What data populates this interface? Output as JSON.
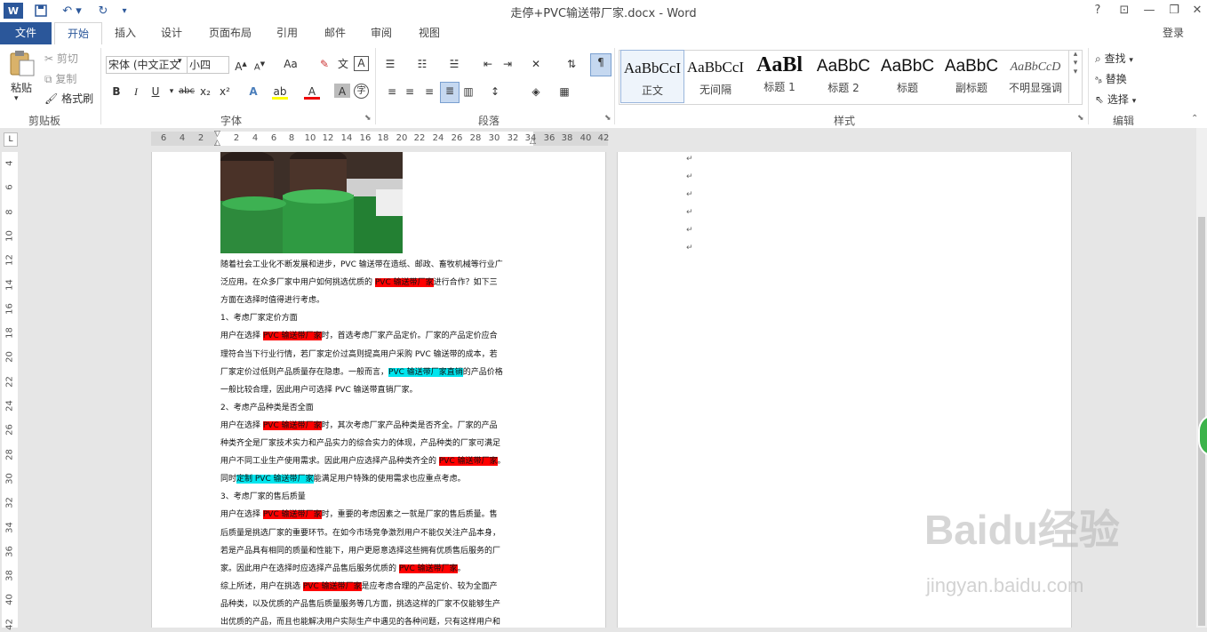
{
  "window": {
    "title": "走停+PVC输送带厂家.docx - Word",
    "controls": {
      "help": "?",
      "restore_ribbon": "⊡",
      "minimize": "—",
      "maximize": "❐",
      "close": "✕"
    },
    "signin": "登录"
  },
  "tabs": [
    "文件",
    "开始",
    "插入",
    "设计",
    "页面布局",
    "引用",
    "邮件",
    "审阅",
    "视图"
  ],
  "clipboard": {
    "paste": "粘贴",
    "cut": "剪切",
    "copy": "复制",
    "format_painter": "格式刷",
    "group": "剪贴板"
  },
  "font": {
    "family": "宋体 (中文正文",
    "size": "小四",
    "group": "字体",
    "change_case": "Aa",
    "bold": "B",
    "italic": "I",
    "underline": "U",
    "strike": "abc",
    "subscript": "x₂",
    "superscript": "x²"
  },
  "paragraph": {
    "group": "段落"
  },
  "styles": {
    "group": "样式",
    "items": [
      {
        "sample": "AaBbCcI",
        "name": "正文"
      },
      {
        "sample": "AaBbCcI",
        "name": "无间隔"
      },
      {
        "sample": "AaBl",
        "name": "标题 1"
      },
      {
        "sample": "AaBbC",
        "name": "标题 2"
      },
      {
        "sample": "AaBbC",
        "name": "标题"
      },
      {
        "sample": "AaBbC",
        "name": "副标题"
      },
      {
        "sample": "AaBbCcD",
        "name": "不明显强调"
      }
    ]
  },
  "editing": {
    "find": "查找",
    "replace": "替换",
    "select": "选择",
    "group": "编辑"
  },
  "ruler": {
    "h_ticks": [
      "6",
      "4",
      "2",
      "2",
      "4",
      "6",
      "8",
      "10",
      "12",
      "14",
      "16",
      "18",
      "20",
      "22",
      "24",
      "26",
      "28",
      "30",
      "32",
      "34",
      "36",
      "38",
      "40",
      "42"
    ],
    "v_ticks": [
      "4",
      "6",
      "8",
      "10",
      "12",
      "14",
      "16",
      "18",
      "20",
      "22",
      "24",
      "26",
      "28",
      "30",
      "32",
      "34",
      "36",
      "38",
      "40",
      "42"
    ]
  },
  "document": {
    "lines": [
      [
        {
          "t": "随着社会工业化不断发展和进步，PVC 输送带在造纸、邮政、畜牧机械等行业广"
        }
      ],
      [
        {
          "t": "泛应用。在众多厂家中用户如何挑选优质的 "
        },
        {
          "t": "PVC 输送带厂家",
          "h": "red"
        },
        {
          "t": "进行合作？如下三"
        }
      ],
      [
        {
          "t": "方面在选择时值得进行考虑。"
        }
      ],
      [
        {
          "t": "1、考虑厂家定价方面"
        }
      ],
      [
        {
          "t": "用户在选择 "
        },
        {
          "t": "PVC 输送带厂家",
          "h": "red"
        },
        {
          "t": "时，首选考虑厂家产品定价。厂家的产品定价应合"
        }
      ],
      [
        {
          "t": "理符合当下行业行情，若厂家定价过高则提高用户采购 PVC 输送带的成本，若"
        }
      ],
      [
        {
          "t": "厂家定价过低则产品质量存在隐患。一般而言，"
        },
        {
          "t": "PVC 输送带厂家直销",
          "h": "cyan"
        },
        {
          "t": "的产品价格"
        }
      ],
      [
        {
          "t": "一般比较合理，因此用户可选择 PVC 输送带直销厂家。"
        }
      ],
      [
        {
          "t": "2、考虑产品种类是否全面"
        }
      ],
      [
        {
          "t": "用户在选择 "
        },
        {
          "t": "PVC 输送带厂家",
          "h": "red"
        },
        {
          "t": "时，其次考虑厂家产品种类是否齐全。厂家的产品"
        }
      ],
      [
        {
          "t": "种类齐全是厂家技术实力和产品实力的综合实力的体现，产品种类的厂家可满足"
        }
      ],
      [
        {
          "t": "用户不同工业生产使用需求。因此用户应选择产品种类齐全的 "
        },
        {
          "t": "PVC 输送带厂家",
          "h": "red"
        },
        {
          "t": "。"
        }
      ],
      [
        {
          "t": "同时"
        },
        {
          "t": "定制 PVC 输送带厂家",
          "h": "cyan"
        },
        {
          "t": "能满足用户特殊的使用需求也应重点考虑。"
        }
      ],
      [
        {
          "t": "3、考虑厂家的售后质量"
        }
      ],
      [
        {
          "t": "用户在选择 "
        },
        {
          "t": "PVC 输送带厂家",
          "h": "red"
        },
        {
          "t": "时，重要的考虑因素之一就是厂家的售后质量。售"
        }
      ],
      [
        {
          "t": "后质量是挑选厂家的重要环节。在如今市场竞争激烈用户不能仅关注产品本身，"
        }
      ],
      [
        {
          "t": "若是产品具有相同的质量和性能下，用户更愿意选择这些拥有优质售后服务的厂"
        }
      ],
      [
        {
          "t": "家。因此用户在选择时应选择产品售后服务优质的 "
        },
        {
          "t": "PVC 输送带厂家",
          "h": "red"
        },
        {
          "t": "。"
        }
      ],
      [
        {
          "t": "综上所述，用户在挑选 "
        },
        {
          "t": "PVC 输送带厂家",
          "h": "red"
        },
        {
          "t": "是应考虑合理的产品定价、较为全面产"
        }
      ],
      [
        {
          "t": "品种类，以及优质的产品售后质量服务等几方面，挑选这样的厂家不仅能够生产"
        }
      ],
      [
        {
          "t": "出优质的产品，而且也能解决用户实际生产中遇见的各种问题，只有这样用户和"
        }
      ]
    ]
  },
  "watermark": {
    "main": "Baidu经验",
    "sub": "jingyan.baidu.com"
  },
  "colors": {
    "accent": "#2b579a",
    "highlight_red": "#ff0000",
    "highlight_cyan": "#00e5ee"
  }
}
